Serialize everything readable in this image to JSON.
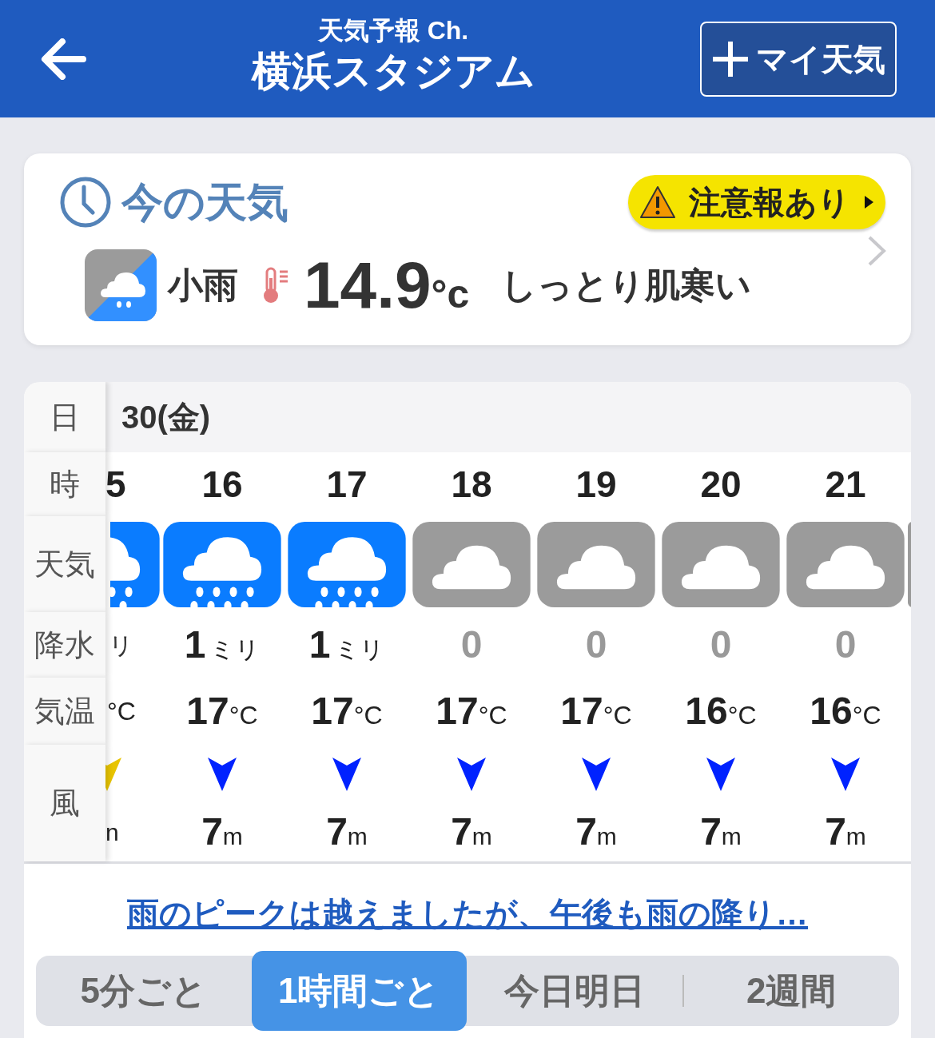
{
  "header": {
    "subtitle": "天気予報 Ch.",
    "title": "横浜スタジアム",
    "add_button": "マイ天気"
  },
  "now": {
    "heading": "今の天気",
    "alert": "注意報あり",
    "condition": "小雨",
    "temperature": "14.9",
    "temperature_unit": "°c",
    "feeling": "しっとり肌寒い"
  },
  "hourly": {
    "labels": [
      "日",
      "時",
      "天気",
      "降水",
      "気温",
      "風"
    ],
    "date": "30(金)",
    "partial_column": {
      "hour": "5",
      "kind": "rain",
      "precip_unit": "リ",
      "temp_unit": "°C",
      "wind_unit": "n",
      "color": "#e8c400"
    },
    "hours": [
      {
        "hour": "16",
        "kind": "rain",
        "precip": "1",
        "precip_unit": "ミリ",
        "temp": "17",
        "temp_unit": "°C",
        "wind": "7",
        "wind_unit": "m",
        "color": "#0022ff"
      },
      {
        "hour": "17",
        "kind": "rain",
        "precip": "1",
        "precip_unit": "ミリ",
        "temp": "17",
        "temp_unit": "°C",
        "wind": "7",
        "wind_unit": "m",
        "color": "#0022ff"
      },
      {
        "hour": "18",
        "kind": "cloudy",
        "precip": "0",
        "temp": "17",
        "temp_unit": "°C",
        "wind": "7",
        "wind_unit": "m",
        "color": "#0022ff"
      },
      {
        "hour": "19",
        "kind": "cloudy",
        "precip": "0",
        "temp": "17",
        "temp_unit": "°C",
        "wind": "7",
        "wind_unit": "m",
        "color": "#0022ff"
      },
      {
        "hour": "20",
        "kind": "cloudy",
        "precip": "0",
        "temp": "16",
        "temp_unit": "°C",
        "wind": "7",
        "wind_unit": "m",
        "color": "#0022ff"
      },
      {
        "hour": "21",
        "kind": "cloudy",
        "precip": "0",
        "temp": "16",
        "temp_unit": "°C",
        "wind": "7",
        "wind_unit": "m",
        "color": "#0022ff"
      }
    ]
  },
  "comment_link": "雨のピークは越えましたが、午後も雨の降り…",
  "tabs": [
    {
      "label": "5分ごと",
      "selected": false
    },
    {
      "label": "1時間ごと",
      "selected": true
    },
    {
      "label": "今日明日",
      "selected": false
    },
    {
      "label": "2週間",
      "selected": false
    }
  ]
}
